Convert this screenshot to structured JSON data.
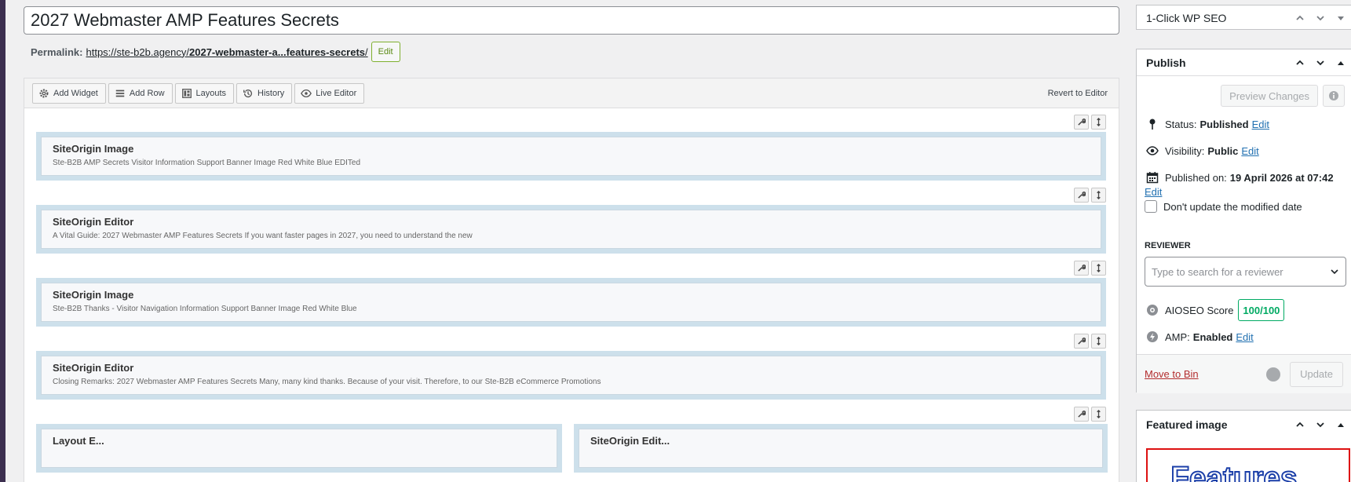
{
  "editor": {
    "title": "2027 Webmaster AMP Features Secrets",
    "permalink": {
      "label": "Permalink:",
      "url_base": "https://ste-b2b.agency/",
      "url_slug": "2027-webmaster-a...features-secrets",
      "url_trailing": "/",
      "edit_label": "Edit"
    }
  },
  "builder": {
    "toolbar": {
      "add_widget": "Add Widget",
      "add_row": "Add Row",
      "layouts": "Layouts",
      "history": "History",
      "live_editor": "Live Editor",
      "revert": "Revert to Editor"
    },
    "widgets": [
      {
        "title": "SiteOrigin Image",
        "desc": "Ste-B2B AMP Secrets Visitor Information Support Banner Image Red White Blue EDITed"
      },
      {
        "title": "SiteOrigin Editor",
        "desc": "A Vital Guide: 2027 Webmaster AMP Features Secrets If you want faster pages in 2027, you need to understand the new"
      },
      {
        "title": "SiteOrigin Image",
        "desc": "Ste-B2B Thanks - Visitor Navigation Information Support Banner Image Red White Blue"
      },
      {
        "title": "SiteOrigin Editor",
        "desc": "Closing Remarks: 2027 Webmaster AMP Features Secrets Many, many kind thanks. Because of your visit. Therefore, to our Ste-B2B eCommerce Promotions"
      }
    ],
    "partial_widgets": [
      {
        "title": "Layout E..."
      },
      {
        "title": "SiteOrigin Edit..."
      }
    ]
  },
  "sidebar": {
    "seo_panel": {
      "title": "1-Click WP SEO"
    },
    "publish": {
      "title": "Publish",
      "preview_label": "Preview Changes",
      "status_label": "Status:",
      "status_value": "Published",
      "visibility_label": "Visibility:",
      "visibility_value": "Public",
      "published_label": "Published on:",
      "published_value": "19 April 2026 at 07:42",
      "edit_label": "Edit",
      "dont_update_label": "Don't update the modified date",
      "reviewer_label": "REVIEWER",
      "reviewer_placeholder": "Type to search for a reviewer",
      "aioseo_label": "AIOSEO Score",
      "aioseo_score": "100/100",
      "amp_label": "AMP:",
      "amp_value": "Enabled",
      "move_to_bin": "Move to Bin",
      "update_label": "Update"
    },
    "featured": {
      "title": "Featured image",
      "image_text": "Features"
    }
  },
  "colors": {
    "admin_strip": "#3c2f4f",
    "link": "#2271b1",
    "score_green": "#00aa63",
    "trash_red": "#b32d2e",
    "row_bg": "#cde0eb"
  }
}
